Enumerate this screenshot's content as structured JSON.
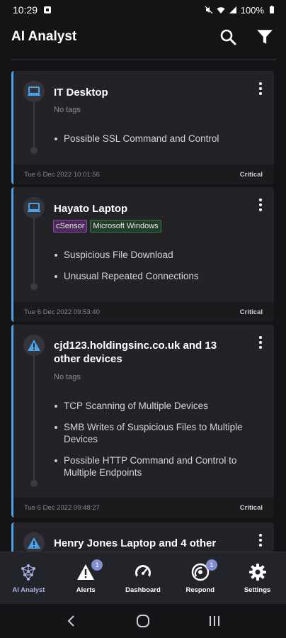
{
  "status_bar": {
    "time": "10:29",
    "battery": "100%"
  },
  "app": {
    "title": "AI Analyst"
  },
  "cards": [
    {
      "device": "IT Desktop",
      "no_tags_label": "No tags",
      "alerts": [
        "Possible SSL Command and Control"
      ],
      "timestamp": "Tue 6 Dec 2022 10:01:56",
      "severity": "Critical"
    },
    {
      "device": "Hayato Laptop",
      "tags": [
        "cSensor",
        "Microsoft Windows"
      ],
      "alerts": [
        "Suspicious File Download",
        "Unusual Repeated Connections"
      ],
      "timestamp": "Tue 6 Dec 2022 09:53:40",
      "severity": "Critical"
    },
    {
      "device_line1": "cjd123.holdingsinc.co.uk and 13",
      "device_line2": "other devices",
      "no_tags_label": "No tags",
      "alerts": [
        "TCP Scanning of Multiple Devices",
        "SMB Writes of Suspicious Files to Multiple Devices",
        "Possible HTTP Command and Control to Multiple Endpoints"
      ],
      "timestamp": "Tue 6 Dec 2022 09:48:27",
      "severity": "Critical"
    },
    {
      "device": "Henry Jones Laptop and 4 other"
    }
  ],
  "nav": [
    {
      "label": "AI Analyst",
      "icon": "network-icon",
      "active": true
    },
    {
      "label": "Alerts",
      "icon": "warning-icon",
      "badge": "1"
    },
    {
      "label": "Dashboard",
      "icon": "gauge-icon"
    },
    {
      "label": "Respond",
      "icon": "respond-icon",
      "badge": "1"
    },
    {
      "label": "Settings",
      "icon": "gear-icon"
    }
  ],
  "colors": {
    "accent": "#4aa3e6",
    "background": "#141417",
    "card": "#232327",
    "badge": "#7f8fd1"
  }
}
